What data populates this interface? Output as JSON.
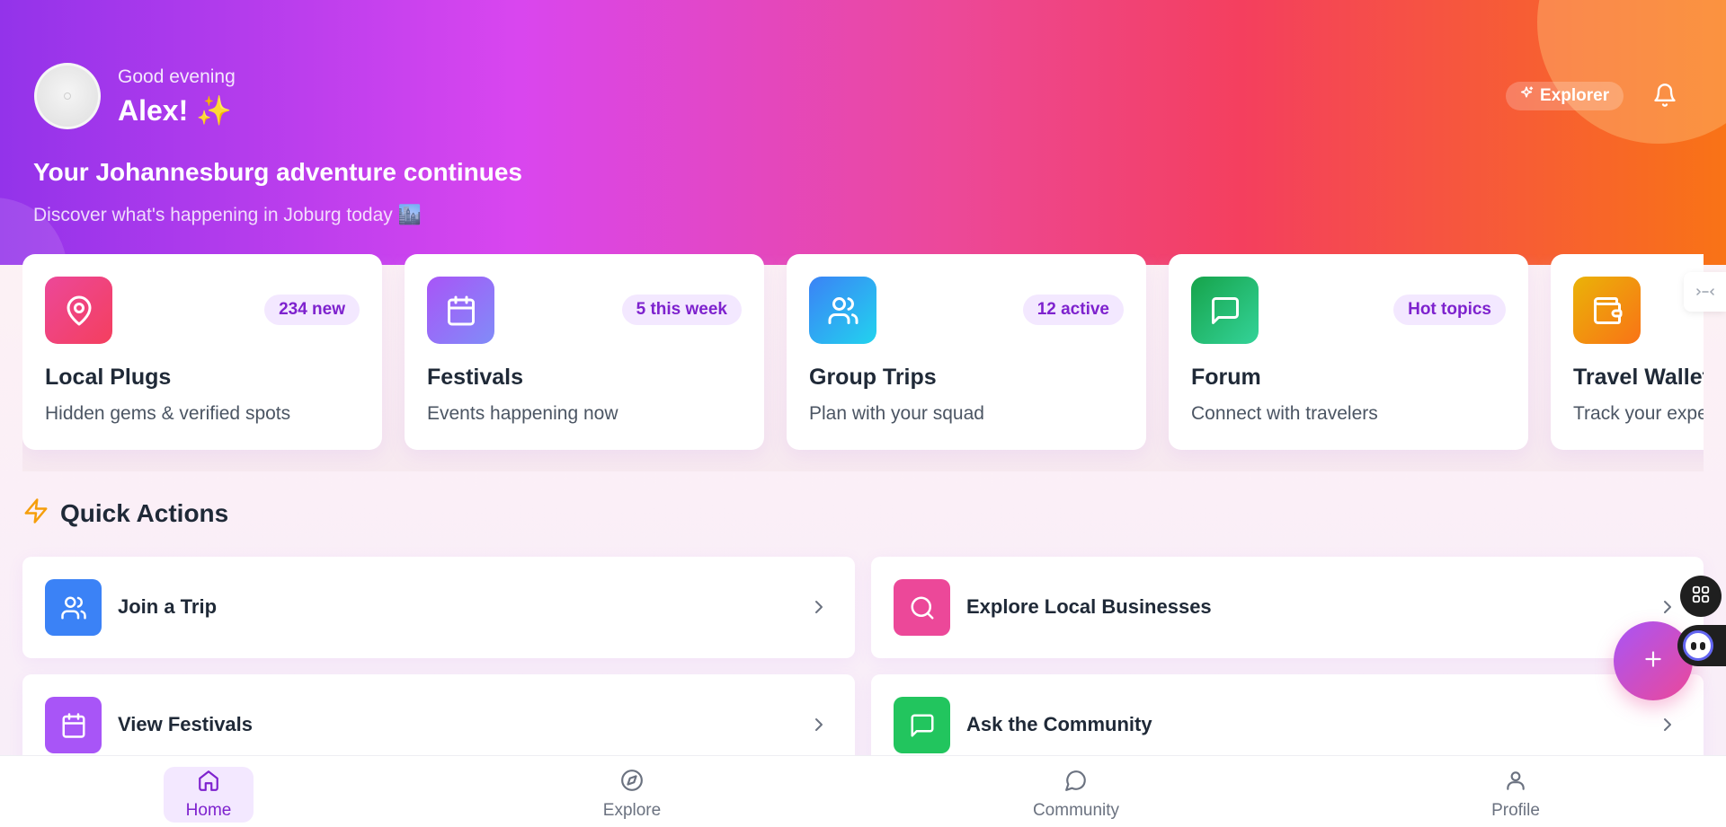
{
  "header": {
    "greeting": "Good evening",
    "username": "Alex! ✨",
    "title": "Your Johannesburg adventure continues",
    "subtitle": "Discover what's happening in Joburg today 🏙️",
    "badge_label": "Explorer",
    "icons": [
      "sparkles-icon",
      "bell-icon"
    ]
  },
  "feature_cards": [
    {
      "title": "Local Plugs",
      "description": "Hidden gems & verified spots",
      "badge": "234 new",
      "icon": "map-pin-icon",
      "color": "#ec4899"
    },
    {
      "title": "Festivals",
      "description": "Events happening now",
      "badge": "5 this week",
      "icon": "calendar-icon",
      "color": "#a855f7"
    },
    {
      "title": "Group Trips",
      "description": "Plan with your squad",
      "badge": "12 active",
      "icon": "users-icon",
      "color": "#3b82f6"
    },
    {
      "title": "Forum",
      "description": "Connect with travelers",
      "badge": "Hot topics",
      "icon": "message-icon",
      "color": "#22c55e"
    },
    {
      "title": "Travel Wallet",
      "description": "Track your expenses",
      "badge": "",
      "icon": "wallet-icon",
      "color": "#f59e0b"
    }
  ],
  "quick_actions": {
    "title": "Quick Actions",
    "items": [
      {
        "label": "Join a Trip",
        "icon": "users-icon",
        "color": "#3b82f6"
      },
      {
        "label": "Explore Local Businesses",
        "icon": "search-icon",
        "color": "#ec4899"
      },
      {
        "label": "View Festivals",
        "icon": "calendar-icon",
        "color": "#a855f7"
      },
      {
        "label": "Ask the Community",
        "icon": "message-icon",
        "color": "#22c55e"
      }
    ]
  },
  "bottom_nav": {
    "items": [
      {
        "label": "Home",
        "icon": "home-icon",
        "active": true
      },
      {
        "label": "Explore",
        "icon": "compass-icon",
        "active": false
      },
      {
        "label": "Community",
        "icon": "chat-icon",
        "active": false
      },
      {
        "label": "Profile",
        "icon": "user-icon",
        "active": false
      }
    ]
  },
  "colors": {
    "hero_gradient": [
      "#9333ea",
      "#d946ef",
      "#ec4899",
      "#f43f5e",
      "#f97316"
    ],
    "accent": "#7e22ce",
    "badge_bg": "#f3e8ff"
  }
}
